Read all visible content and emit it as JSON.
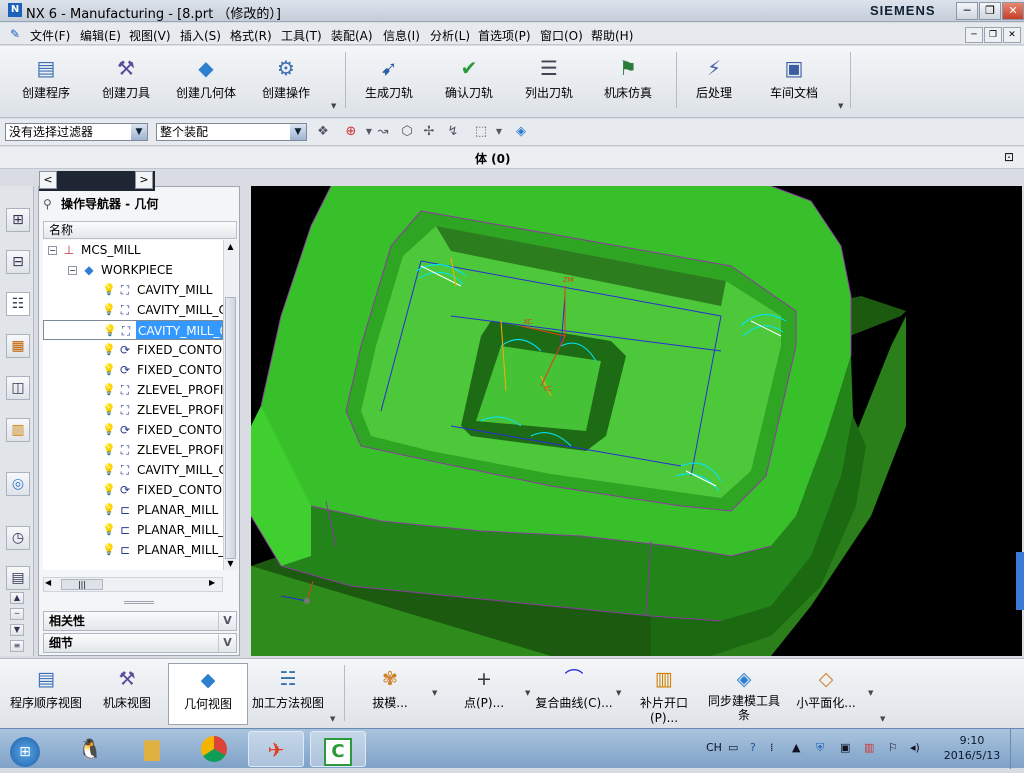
{
  "window": {
    "title": "NX 6 - Manufacturing - [8.prt （修改的）]",
    "brand": "SIEMENS",
    "logo": "N"
  },
  "menu": [
    "文件(F)",
    "编辑(E)",
    "视图(V)",
    "插入(S)",
    "格式(R)",
    "工具(T)",
    "装配(A)",
    "信息(I)",
    "分析(L)",
    "首选项(P)",
    "窗口(O)",
    "帮助(H)"
  ],
  "ribbon": [
    {
      "label": "创建程序",
      "icon": "create-program-icon"
    },
    {
      "label": "创建刀具",
      "icon": "create-tool-icon"
    },
    {
      "label": "创建几何体",
      "icon": "create-geometry-icon"
    },
    {
      "label": "创建操作",
      "icon": "create-operation-icon"
    },
    {
      "label": "生成刀轨",
      "icon": "generate-path-icon"
    },
    {
      "label": "确认刀轨",
      "icon": "verify-path-icon"
    },
    {
      "label": "列出刀轨",
      "icon": "list-path-icon"
    },
    {
      "label": "机床仿真",
      "icon": "machine-sim-icon"
    },
    {
      "label": "后处理",
      "icon": "postprocess-icon"
    },
    {
      "label": "车间文档",
      "icon": "shop-doc-icon"
    }
  ],
  "filter": {
    "selection_filter": "没有选择过滤器",
    "scope": "整个装配"
  },
  "part_bar": {
    "label": "体 (0)"
  },
  "navigator": {
    "title": "操作导航器 - 几何",
    "column": "名称",
    "root": "MCS_MILL",
    "workpiece": "WORKPIECE",
    "operations": [
      {
        "name": "CAVITY_MILL",
        "type": "cavity"
      },
      {
        "name": "CAVITY_MILL_C",
        "type": "cavity"
      },
      {
        "name": "CAVITY_MILL_C",
        "type": "cavity",
        "selected": true
      },
      {
        "name": "FIXED_CONTOU",
        "type": "fixed"
      },
      {
        "name": "FIXED_CONTOU",
        "type": "fixed"
      },
      {
        "name": "ZLEVEL_PROFIL",
        "type": "zlevel"
      },
      {
        "name": "ZLEVEL_PROFIL",
        "type": "zlevel"
      },
      {
        "name": "FIXED_CONTOU",
        "type": "fixed"
      },
      {
        "name": "ZLEVEL_PROFIL",
        "type": "zlevel"
      },
      {
        "name": "CAVITY_MILL_C",
        "type": "cavity"
      },
      {
        "name": "FIXED_CONTOU",
        "type": "fixed"
      },
      {
        "name": "PLANAR_MILL",
        "type": "planar"
      },
      {
        "name": "PLANAR_MILL_",
        "type": "planar"
      },
      {
        "name": "PLANAR_MILL_",
        "type": "planar"
      }
    ],
    "panels": [
      "相关性",
      "细节"
    ]
  },
  "bottom_toolbar": {
    "views": [
      {
        "label": "程序顺序视图",
        "active": false
      },
      {
        "label": "机床视图",
        "active": false
      },
      {
        "label": "几何视图",
        "active": true
      },
      {
        "label": "加工方法视图",
        "active": false
      }
    ],
    "tools": [
      "拔模...",
      "点(P)...",
      "复合曲线(C)...",
      "补片开口(P)...",
      "同步建模工具条",
      "小平面化..."
    ]
  },
  "viewport_labels": {
    "zm": "ZM",
    "xc": "XC",
    "yc": "YC"
  },
  "taskbar": {
    "ime": "CH",
    "time": "9:10",
    "date": "2016/5/13"
  }
}
